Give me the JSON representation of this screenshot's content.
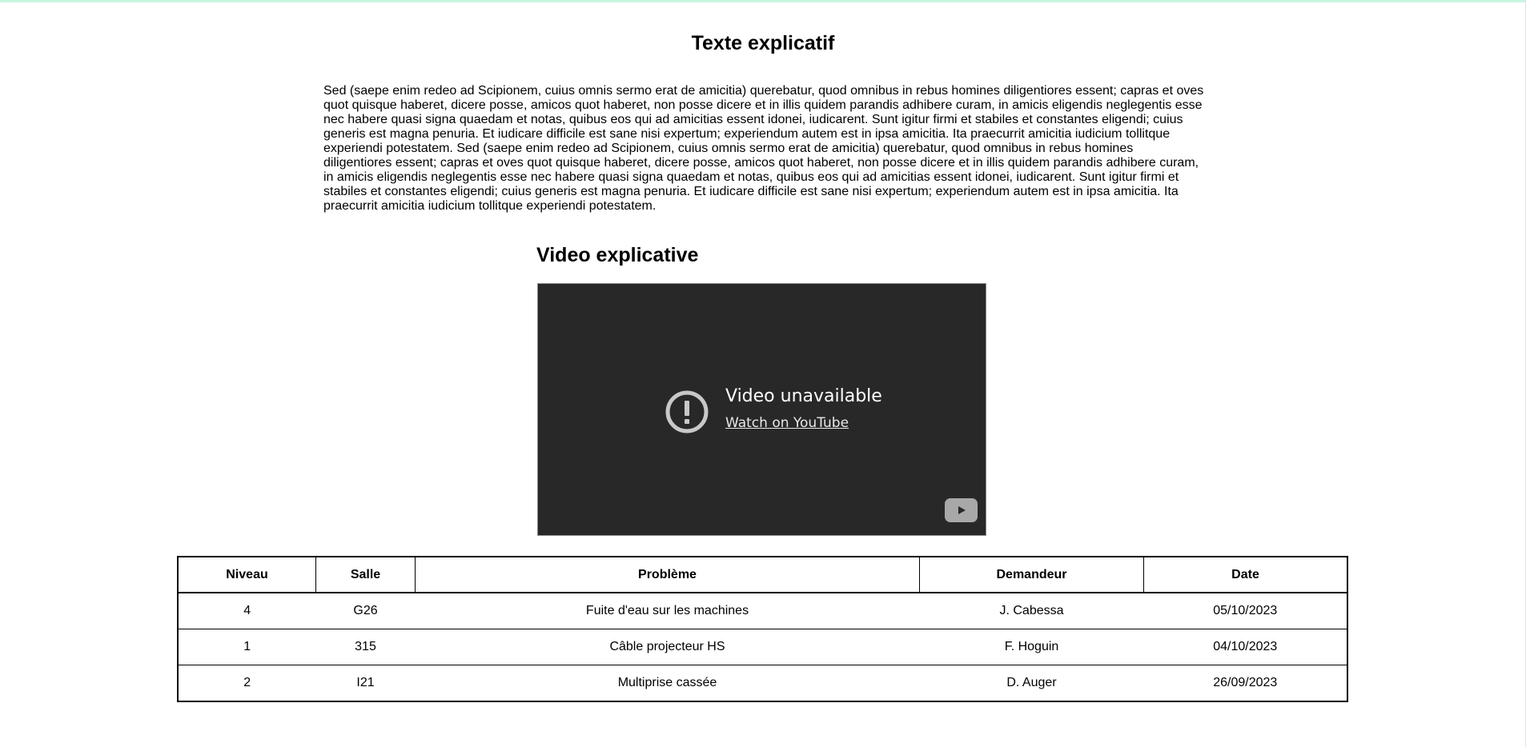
{
  "page": {
    "title": "Texte explicatif",
    "paragraph": "Sed (saepe enim redeo ad Scipionem, cuius omnis sermo erat de amicitia) querebatur, quod omnibus in rebus homines diligentiores essent; capras et oves quot quisque haberet, dicere posse, amicos quot haberet, non posse dicere et in illis quidem parandis adhibere curam, in amicis eligendis neglegentis esse nec habere quasi signa quaedam et notas, quibus eos qui ad amicitias essent idonei, iudicarent. Sunt igitur firmi et stabiles et constantes eligendi; cuius generis est magna penuria. Et iudicare difficile est sane nisi expertum; experiendum autem est in ipsa amicitia. Ita praecurrit amicitia iudicium tollitque experiendi potestatem. Sed (saepe enim redeo ad Scipionem, cuius omnis sermo erat de amicitia) querebatur, quod omnibus in rebus homines diligentiores essent; capras et oves quot quisque haberet, dicere posse, amicos quot haberet, non posse dicere et in illis quidem parandis adhibere curam, in amicis eligendis neglegentis esse nec habere quasi signa quaedam et notas, quibus eos qui ad amicitias essent idonei, iudicarent. Sunt igitur firmi et stabiles et constantes eligendi; cuius generis est magna penuria. Et iudicare difficile est sane nisi expertum; experiendum autem est in ipsa amicitia. Ita praecurrit amicitia iudicium tollitque experiendi potestatem."
  },
  "video": {
    "heading": "Video explicative",
    "status": "Video unavailable",
    "watch_link": "Watch on YouTube",
    "icons": [
      "alert-circle-icon",
      "youtube-play-icon"
    ]
  },
  "table": {
    "headers": [
      "Niveau",
      "Salle",
      "Problème",
      "Demandeur",
      "Date"
    ],
    "rows": [
      [
        "4",
        "G26",
        "Fuite d'eau sur les machines",
        "J. Cabessa",
        "05/10/2023"
      ],
      [
        "1",
        "315",
        "Câble projecteur HS",
        "F. Hoguin",
        "04/10/2023"
      ],
      [
        "2",
        "I21",
        "Multiprise cassée",
        "D. Auger",
        "26/09/2023"
      ]
    ]
  },
  "colors": {
    "top_border": "#c9f5dd",
    "video_bg": "#282828"
  }
}
